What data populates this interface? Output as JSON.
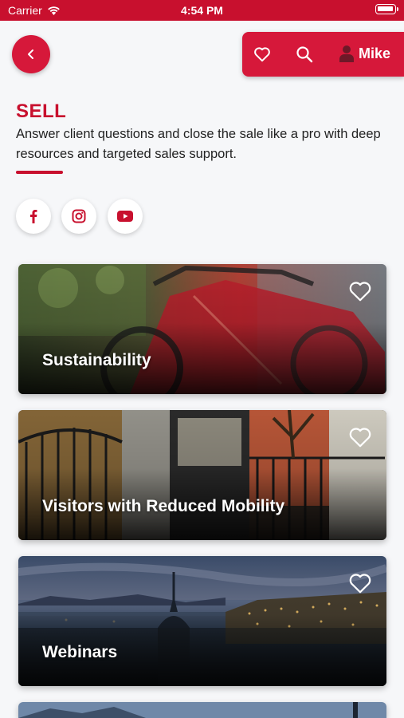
{
  "status_bar": {
    "carrier": "Carrier",
    "time": "4:54 PM"
  },
  "header": {
    "user_name": "Mike"
  },
  "page": {
    "title": "SELL",
    "description": "Answer client questions and close the sale like a pro with deep resources and targeted sales support."
  },
  "social": [
    "facebook-icon",
    "instagram-icon",
    "youtube-icon"
  ],
  "cards": [
    {
      "title": "Sustainability"
    },
    {
      "title": "Visitors with Reduced Mobility"
    },
    {
      "title": "Webinars"
    }
  ],
  "colors": {
    "brand": "#c8102e",
    "brand_button": "#d6183a",
    "background": "#f6f7f9"
  }
}
